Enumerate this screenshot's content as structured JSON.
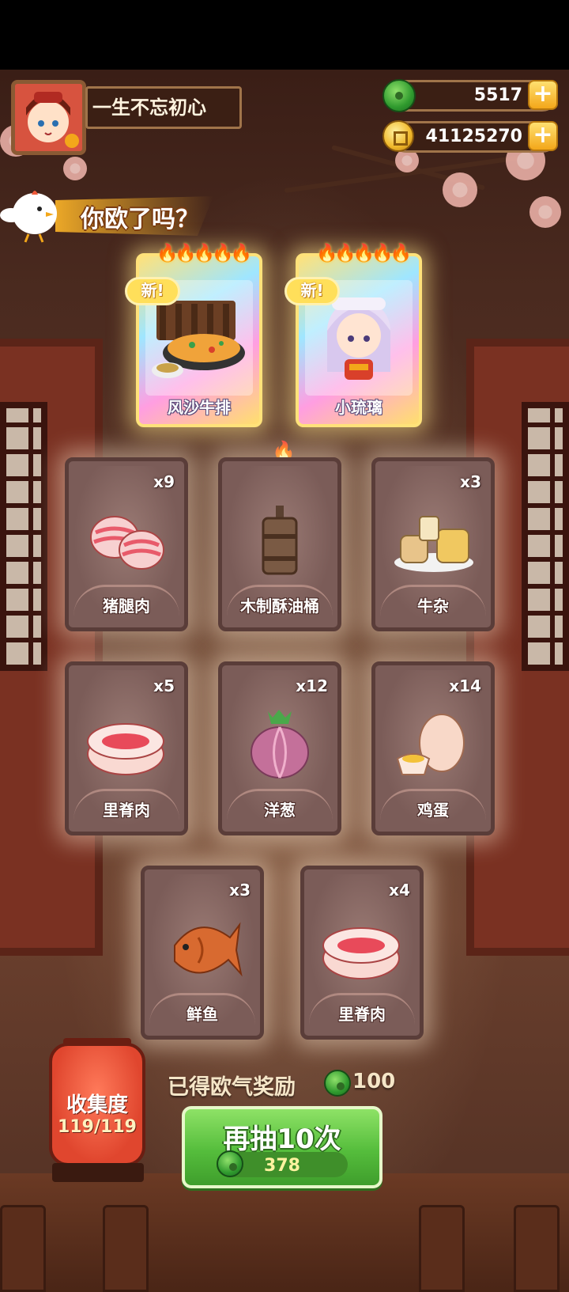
{
  "player": {
    "name": "一生不忘初心"
  },
  "currency": {
    "jade": "5517",
    "gold": "41125270",
    "plus": "+"
  },
  "banner": {
    "text": "你欧了吗？"
  },
  "featured": [
    {
      "name": "风沙牛排",
      "tag": "新",
      "stars": "🔥🔥🔥🔥🔥"
    },
    {
      "name": "小琉璃",
      "tag": "新",
      "stars": "🔥🔥🔥🔥🔥"
    }
  ],
  "cards": [
    {
      "name": "猪腿肉",
      "count": "x9"
    },
    {
      "name": "木制酥油桶",
      "count": ""
    },
    {
      "name": "牛杂",
      "count": "x3"
    },
    {
      "name": "里脊肉",
      "count": "x5"
    },
    {
      "name": "洋葱",
      "count": "x12"
    },
    {
      "name": "鸡蛋",
      "count": "x14"
    },
    {
      "name": "鲜鱼",
      "count": "x3"
    },
    {
      "name": "里脊肉",
      "count": "x4"
    }
  ],
  "collection": {
    "title": "收集度",
    "progress": "119/119"
  },
  "reward": {
    "text": "已得欧气奖励",
    "value": "100"
  },
  "draw": {
    "label": "再抽10次",
    "cost": "378"
  },
  "colors": {
    "button_green": "#55bd3c",
    "gold": "#f3a71a",
    "card_bg": "#7b5c58"
  }
}
